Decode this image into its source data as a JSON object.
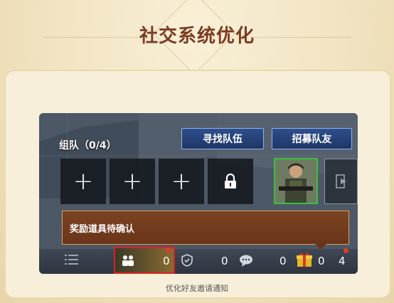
{
  "header": {
    "title": "社交系统优化"
  },
  "team": {
    "label": "组队（0/4）",
    "find_team_label": "寻找队伍",
    "recruit_label": "招募队友",
    "slots": [
      {
        "icon": "plus-icon",
        "glyph": "+"
      },
      {
        "icon": "plus-icon",
        "glyph": "+"
      },
      {
        "icon": "plus-icon",
        "glyph": "+"
      },
      {
        "icon": "lock-icon"
      }
    ]
  },
  "reward_banner": {
    "text": "奖励道具待确认"
  },
  "bottom_bar": {
    "friend_invites": "0",
    "shield_count": "0",
    "chat_count": "0",
    "gift_count": "0",
    "other_count": "4"
  },
  "caption": "优化好友邀请通知",
  "colors": {
    "title": "#7a3c22",
    "highlight_border": "#e1201e",
    "notification_dot": "#e23a2c",
    "online_border": "#38c23a"
  }
}
